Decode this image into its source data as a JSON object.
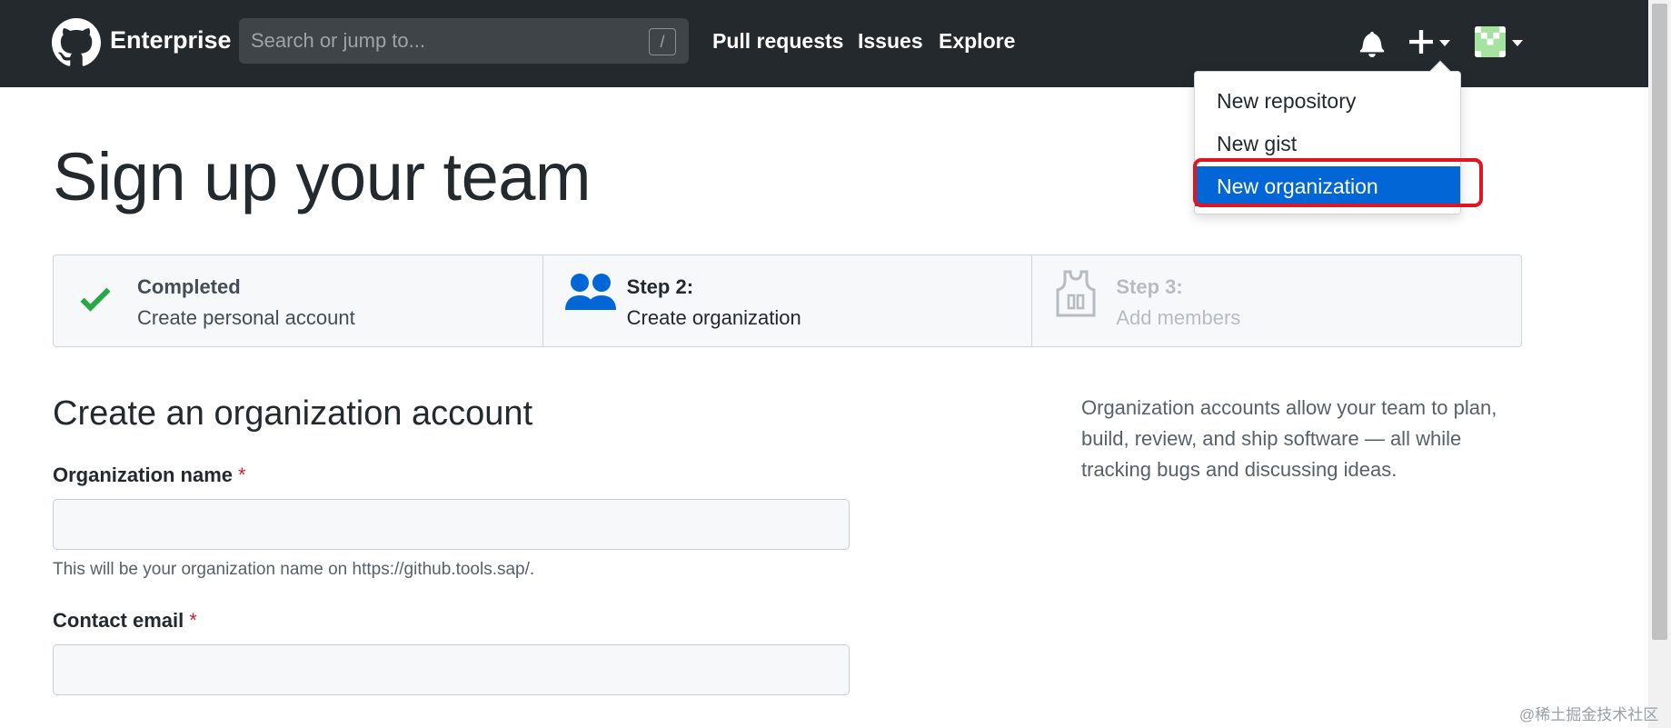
{
  "header": {
    "brand": "Enterprise",
    "search_placeholder": "Search or jump to...",
    "search_shortcut": "/",
    "nav": [
      "Pull requests",
      "Issues",
      "Explore"
    ]
  },
  "dropdown": {
    "items": [
      "New repository",
      "New gist",
      "New organization"
    ],
    "active_index": 2
  },
  "page": {
    "title": "Sign up your team",
    "steps": [
      {
        "title": "Completed",
        "desc": "Create personal account",
        "state": "completed",
        "icon": "check-icon"
      },
      {
        "title": "Step 2:",
        "desc": "Create organization",
        "state": "current",
        "icon": "people-icon"
      },
      {
        "title": "Step 3:",
        "desc": "Add members",
        "state": "disabled",
        "icon": "jersey-icon"
      }
    ],
    "section_title": "Create an organization account",
    "fields": {
      "org_name_label": "Organization name",
      "org_name_required": "*",
      "org_name_value": "",
      "org_name_note": "This will be your organization name on https://github.tools.sap/.",
      "email_label": "Contact email",
      "email_required": "*",
      "email_value": ""
    },
    "sidebar_note": "Organization accounts allow your team to plan, build, review, and ship software — all while tracking bugs and discussing ideas."
  },
  "watermark": "@稀土掘金技术社区",
  "colors": {
    "header_bg": "#24292e",
    "active_item": "#0366d6",
    "highlight_ring": "#e0151f",
    "check_green": "#28a745",
    "people_blue": "#0366d6"
  }
}
